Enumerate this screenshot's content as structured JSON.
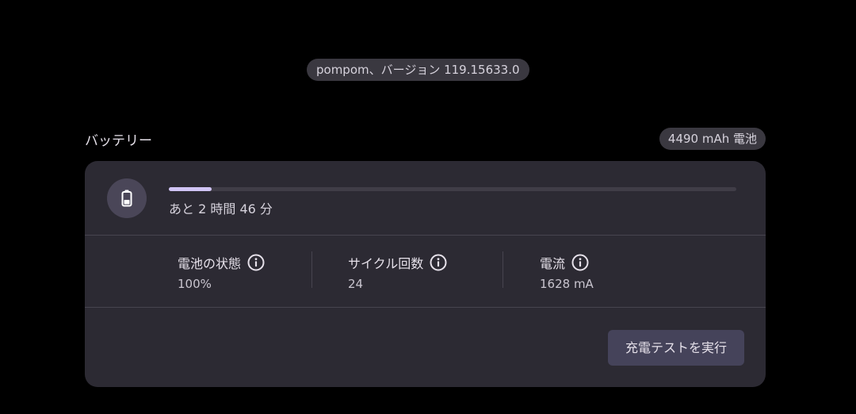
{
  "header": {
    "version_text": "pompom、バージョン 119.15633.0"
  },
  "battery_section": {
    "title": "バッテリー",
    "capacity_label": "4490 mAh 電池",
    "charge_fraction": 0.075,
    "remaining_text": "あと 2 時間 46 分",
    "icon": "battery-icon"
  },
  "stats": [
    {
      "label": "電池の状態",
      "value": "100%",
      "icon": "info-icon"
    },
    {
      "label": "サイクル回数",
      "value": "24",
      "icon": "info-icon"
    },
    {
      "label": "電流",
      "value": "1628 mA",
      "icon": "info-icon"
    }
  ],
  "actions": {
    "run_charge_test_label": "充電テストを実行"
  },
  "colors": {
    "background": "#000000",
    "card": "#2c2a33",
    "chip": "#3a3840",
    "accent": "#d0c4f4",
    "button": "#45435a"
  }
}
